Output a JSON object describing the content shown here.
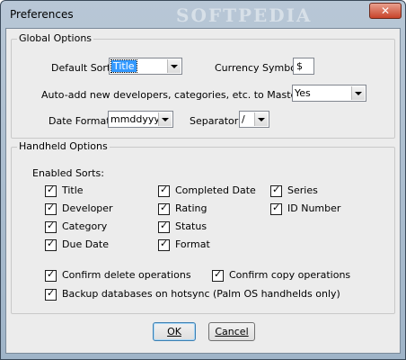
{
  "window": {
    "title": "Preferences",
    "watermark": "SOFTPEDIA",
    "close_icon": "✕"
  },
  "global": {
    "legend": "Global Options",
    "default_sort_label": "Default Sort:",
    "default_sort_value": "Title",
    "currency_label": "Currency Symbol:",
    "currency_value": "$",
    "auto_add_label": "Auto-add new developers, categories, etc. to Master Lists:",
    "auto_add_value": "Yes",
    "date_format_label": "Date Format:",
    "date_format_value": "mmddyyyy",
    "separator_label": "Separator:",
    "separator_value": "/"
  },
  "handheld": {
    "legend": "Handheld Options",
    "enabled_sorts_label": "Enabled Sorts:",
    "sorts": [
      "Title",
      "Developer",
      "Category",
      "Due Date",
      "Completed Date",
      "Rating",
      "Status",
      "Format",
      "Series",
      "ID Number"
    ],
    "confirm_delete": "Confirm delete operations",
    "confirm_copy": "Confirm copy operations",
    "backup": "Backup databases on hotsync (Palm OS handhelds only)"
  },
  "buttons": {
    "ok": "OK",
    "cancel": "Cancel"
  }
}
